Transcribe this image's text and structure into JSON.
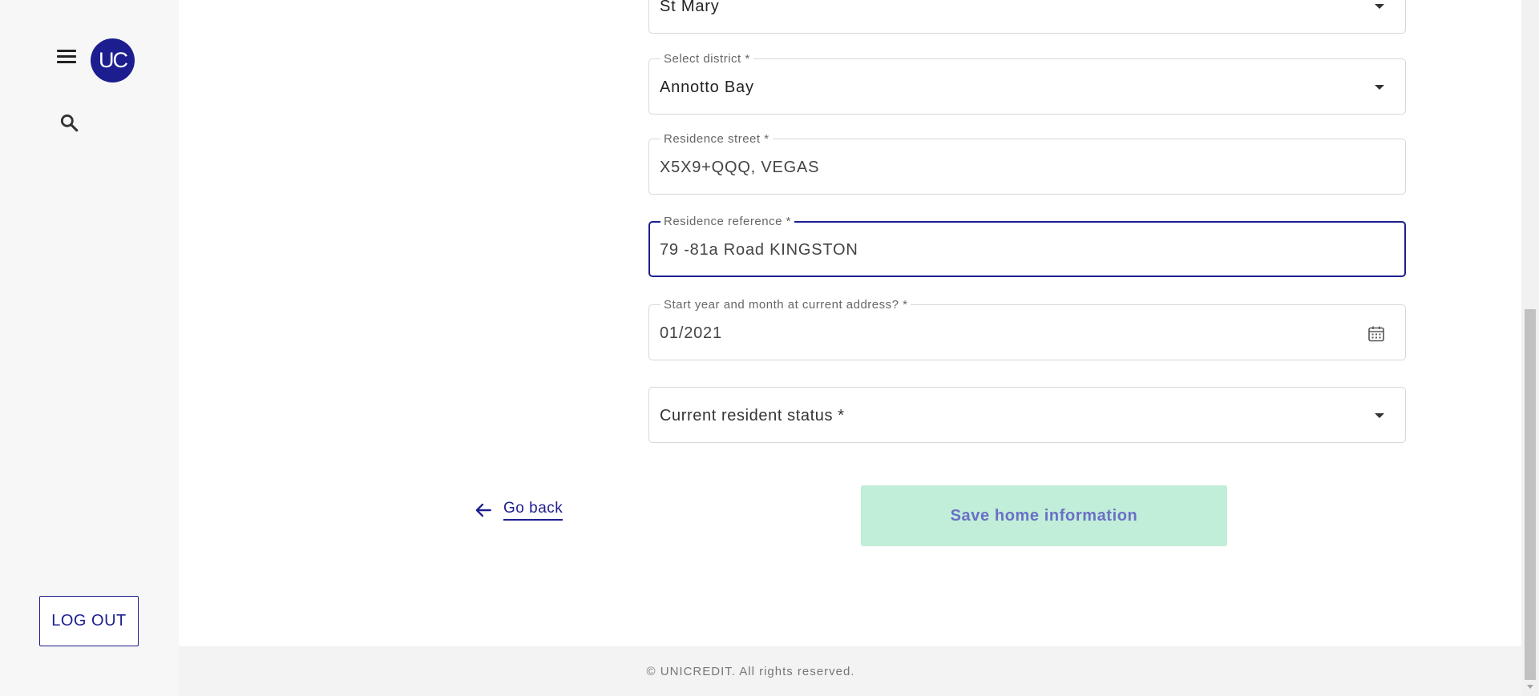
{
  "sidebar": {
    "avatar_text": "UC",
    "logout_label": "LOG OUT"
  },
  "form": {
    "parish": {
      "value": "St Mary"
    },
    "district": {
      "label": "Select district *",
      "value": "Annotto Bay"
    },
    "street": {
      "label": "Residence street *",
      "value": "X5X9+QQQ, VEGAS"
    },
    "reference": {
      "label": "Residence reference *",
      "value": "79 -81a Road KINGSTON"
    },
    "start_date": {
      "label": "Start year and month at current address? *",
      "value": "01/2021"
    },
    "resident_status": {
      "placeholder": "Current resident status *"
    }
  },
  "actions": {
    "go_back_label": "Go back",
    "save_label": "Save home information"
  },
  "footer": {
    "text": "© UNICREDIT. All rights reserved."
  },
  "colors": {
    "brand": "#1c1e8f",
    "save_button_bg": "#c0eed8",
    "save_button_text": "#6b6fc7"
  },
  "icons": [
    "menu-icon",
    "search-icon",
    "chevron-down-icon",
    "calendar-icon",
    "arrow-left-icon"
  ]
}
